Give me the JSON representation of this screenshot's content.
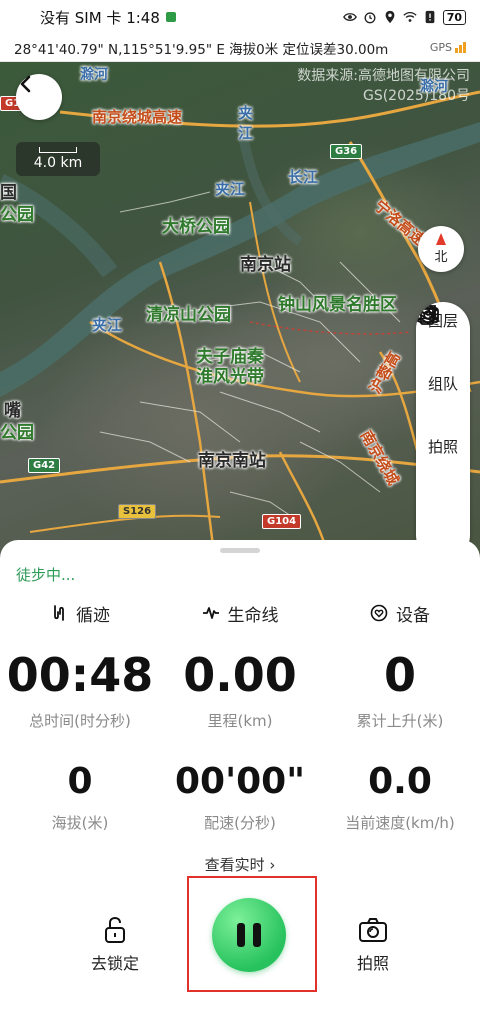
{
  "status_bar": {
    "carrier_time": "没有 SIM 卡 1:48",
    "battery": "70"
  },
  "location_bar": {
    "text": "28°41'40.79\" N,115°51'9.95\" E 海拔0米 定位误差30.00m",
    "gps_label": "GPS"
  },
  "map": {
    "credit_line1": "数据来源:高德地图有限公司",
    "credit_line2": "GS(2025)180号",
    "scale": "4.0 km",
    "compass_label": "北",
    "labels": {
      "daqiao_park": "大桥公园",
      "nanjing_station": "南京站",
      "qingliangshan_park": "清凉山公园",
      "zhongshan_scenic": "钟山风景名胜区",
      "fuzimiao_1": "夫子庙秦",
      "fuzimiao_2": "淮风光带",
      "nanjing_south": "南京南站",
      "changjiang": "长江",
      "jiajiang_1": "夹",
      "jiajiang_2": "江",
      "jiajiang_3": "夹江",
      "jiajiang_4": "夹江",
      "expressway_rao": "南京绕城高速",
      "expressway_ningluo": "宁洛高速",
      "expressway_hu": "沪蓉高",
      "expressway_nanjing_hu": "南京绕城",
      "left_edge_1": "国",
      "left_edge_2": "公园",
      "left_edge_3": "嘴",
      "left_edge_4": "公园",
      "top_river_left": "滁河",
      "top_river_right": "滁河"
    },
    "shields": {
      "g36": "G36",
      "g42": "G42",
      "s126": "S126",
      "g104": "G104",
      "g10": "G10"
    }
  },
  "tools": [
    {
      "label": "图层",
      "icon": "layers-icon"
    },
    {
      "label": "组队",
      "icon": "team-icon"
    },
    {
      "label": "拍照",
      "icon": "camera-icon"
    },
    {
      "label": "",
      "icon": "copy-icon"
    }
  ],
  "sheet": {
    "status": "徒步中...",
    "tabs": [
      {
        "label": "循迹",
        "icon": "track-icon"
      },
      {
        "label": "生命线",
        "icon": "pulse-icon"
      },
      {
        "label": "设备",
        "icon": "device-heart-icon"
      }
    ],
    "stats_row1": [
      {
        "value": "00:48",
        "label": "总时间(时分秒)"
      },
      {
        "value": "0.00",
        "label": "里程(km)"
      },
      {
        "value": "0",
        "label": "累计上升(米)"
      }
    ],
    "stats_row2": [
      {
        "value": "0",
        "label": "海拔(米)"
      },
      {
        "value": "00'00\"",
        "label": "配速(分秒)"
      },
      {
        "value": "0.0",
        "label": "当前速度(km/h)"
      }
    ],
    "realtime_link": "查看实时 ›",
    "lock_label": "去锁定",
    "photo_label": "拍照"
  },
  "colors": {
    "accent_green": "#2e9b58",
    "pause_green": "#27c25e",
    "highlight_red": "#e0322b"
  }
}
